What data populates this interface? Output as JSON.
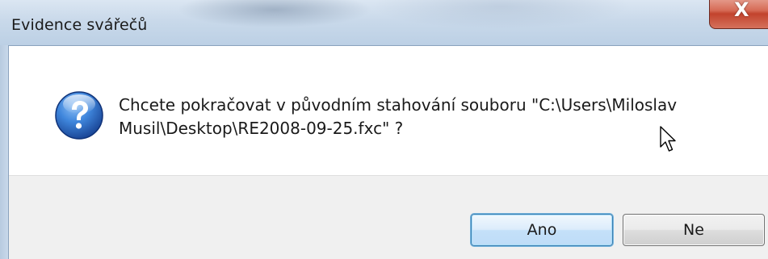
{
  "window": {
    "title": "Evidence svářečů",
    "close_glyph": "X"
  },
  "dialog": {
    "message": "Chcete pokračovat v původním stahování souboru \"C:\\Users\\Miloslav Musil\\Desktop\\RE2008-09-25.fxc\" ?",
    "icon": "question-icon"
  },
  "buttons": {
    "yes_label": "Ano",
    "no_label": "Ne"
  },
  "colors": {
    "icon_blue": "#1f5fb5",
    "default_button_border": "#3c7fb1",
    "close_red": "#c2432d"
  }
}
